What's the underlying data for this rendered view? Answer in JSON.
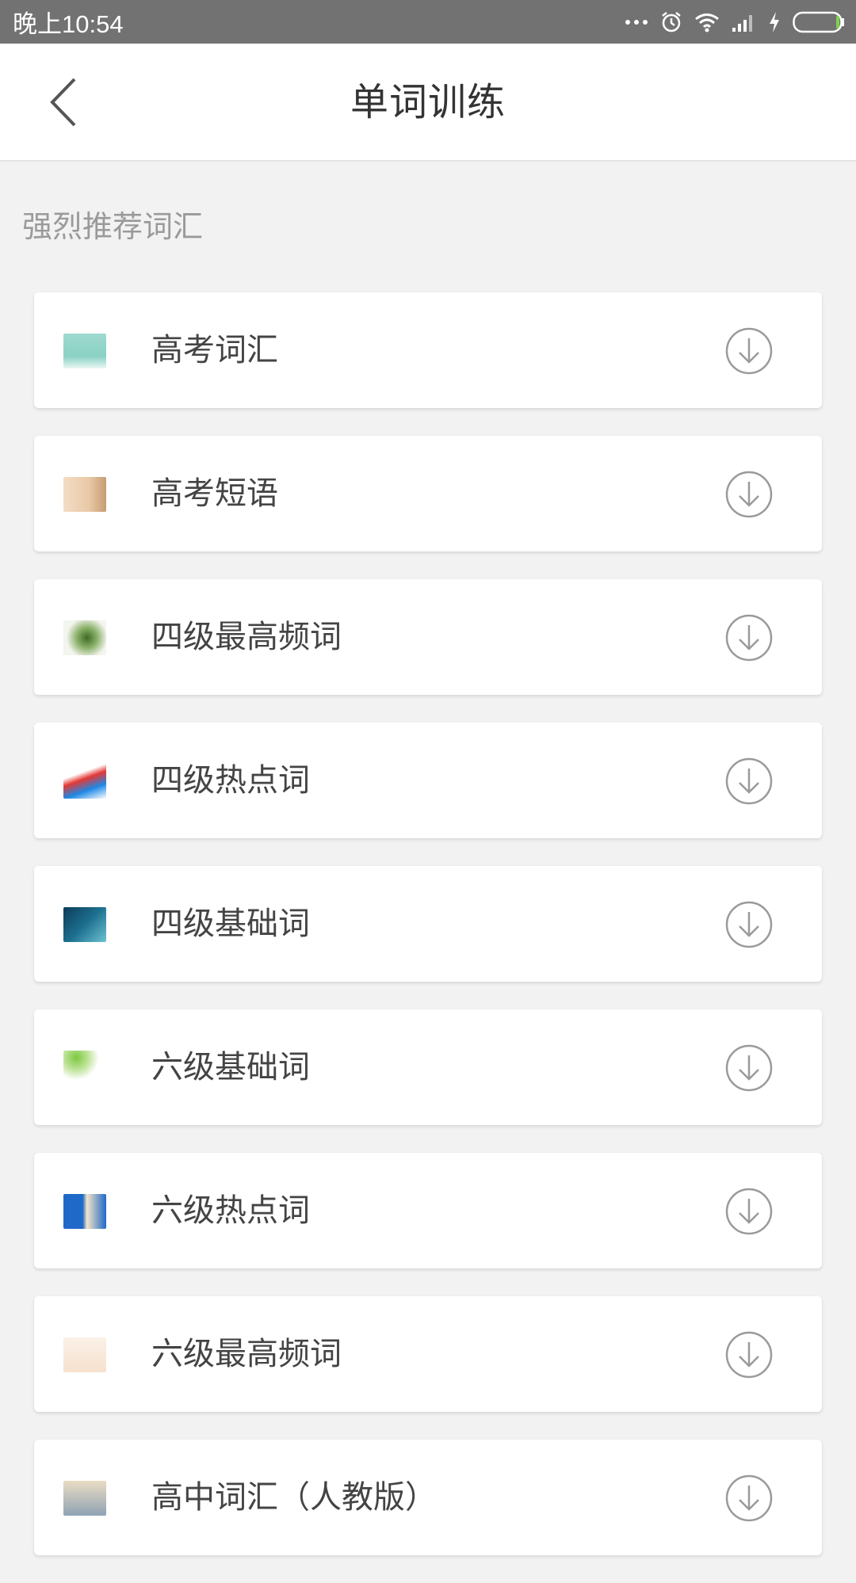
{
  "status_bar": {
    "time": "晚上10:54",
    "icons": [
      "more-dots-icon",
      "alarm-icon",
      "wifi-icon",
      "signal-icon",
      "charging-icon",
      "battery-icon"
    ]
  },
  "header": {
    "title": "单词训练",
    "back_icon": "chevron-left-icon"
  },
  "section": {
    "label": "强烈推荐词汇"
  },
  "items": [
    {
      "label": "高考词汇"
    },
    {
      "label": "高考短语"
    },
    {
      "label": "四级最高频词"
    },
    {
      "label": "四级热点词"
    },
    {
      "label": "四级基础词"
    },
    {
      "label": "六级基础词"
    },
    {
      "label": "六级热点词"
    },
    {
      "label": "六级最高频词"
    },
    {
      "label": "高中词汇（人教版）"
    }
  ],
  "colors": {
    "status_bar": "#727272",
    "background": "#f2f2f2",
    "card": "#ffffff",
    "icon_gray": "#9a9a9a"
  }
}
